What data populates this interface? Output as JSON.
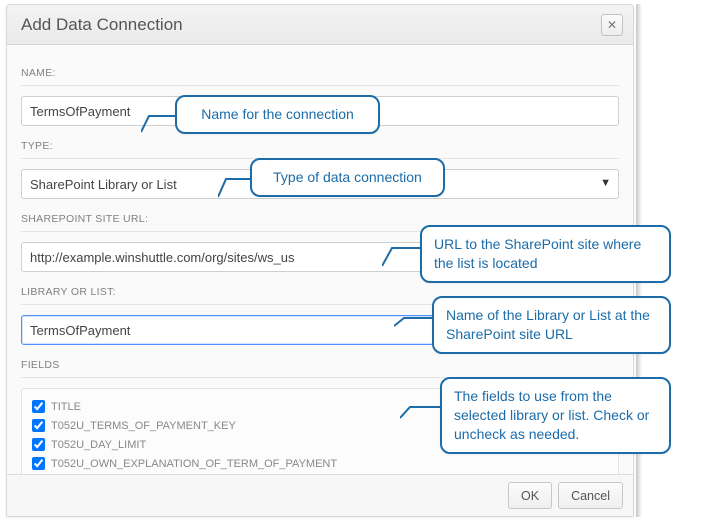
{
  "dialog": {
    "title": "Add Data Connection"
  },
  "labels": {
    "name": "NAME:",
    "type": "TYPE:",
    "url": "SHAREPOINT SITE URL:",
    "library": "LIBRARY OR LIST:",
    "fields": "FIELDS"
  },
  "inputs": {
    "name": "TermsOfPayment",
    "type": "SharePoint Library or List",
    "url": "http://example.winshuttle.com/org/sites/ws_us",
    "library": "TermsOfPayment"
  },
  "fields": {
    "f0": {
      "label": "TITLE",
      "checked": true
    },
    "f1": {
      "label": "T052U_TERMS_OF_PAYMENT_KEY",
      "checked": true
    },
    "f2": {
      "label": "T052U_DAY_LIMIT",
      "checked": true
    },
    "f3": {
      "label": "T052U_OWN_EXPLANATION_OF_TERM_OF_PAYMENT",
      "checked": true
    }
  },
  "buttons": {
    "ok": "OK",
    "cancel": "Cancel"
  },
  "callouts": {
    "c1": "Name for the connection",
    "c2": "Type of data connection",
    "c3": "URL to the SharePoint site where the list is located",
    "c4": "Name of the Library or List at the SharePoint site URL",
    "c5": "The fields to use from the selected library or list. Check or uncheck as needed."
  }
}
